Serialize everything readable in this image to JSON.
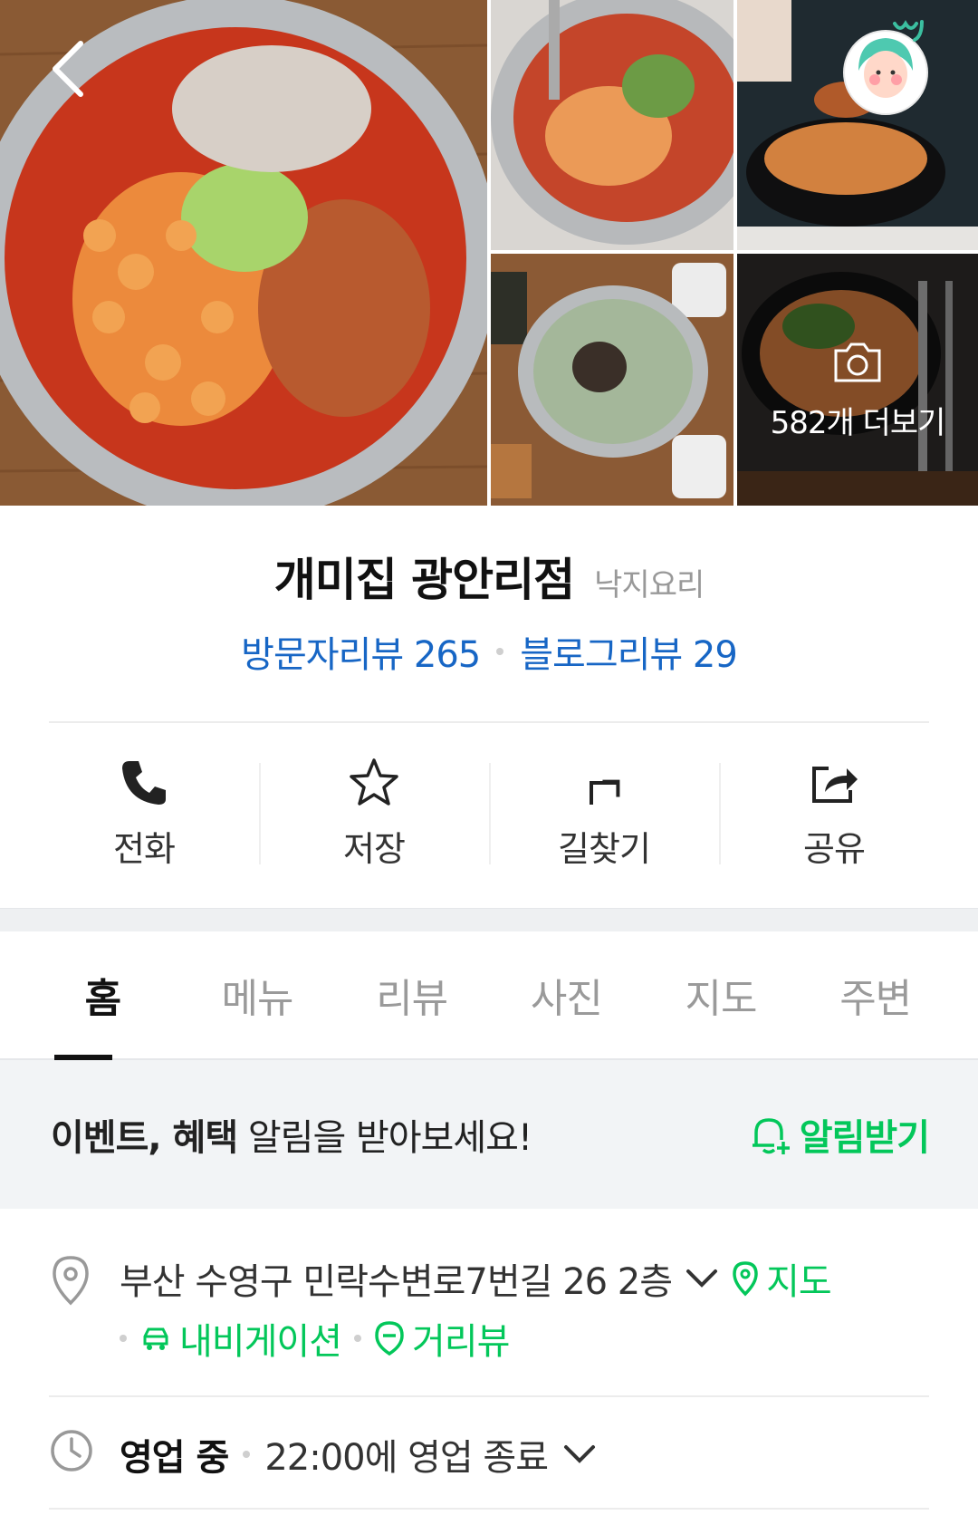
{
  "gallery": {
    "photo_count_label": "582개 더보기"
  },
  "place": {
    "name": "개미집 광안리점",
    "category": "낙지요리",
    "visitor_reviews_label": "방문자리뷰 265",
    "blog_reviews_label": "블로그리뷰 29"
  },
  "actions": {
    "call": "전화",
    "save": "저장",
    "directions": "길찾기",
    "share": "공유"
  },
  "tabs": [
    "홈",
    "메뉴",
    "리뷰",
    "사진",
    "지도",
    "주변"
  ],
  "notice": {
    "bold_text": "이벤트, 혜택",
    "text": " 알림을 받아보세요!",
    "button": "알림받기"
  },
  "address": {
    "text": "부산 수영구 민락수변로7번길 26 2층",
    "map_link": "지도",
    "navigation_link": "내비게이션",
    "street_view_link": "거리뷰"
  },
  "hours": {
    "status": "영업 중",
    "detail": "22:00에 영업 종료"
  },
  "colors": {
    "link_blue": "#1766c5",
    "naver_green": "#03c75a",
    "active_tab": "#111111",
    "inactive_tab": "#9a9a9a"
  }
}
